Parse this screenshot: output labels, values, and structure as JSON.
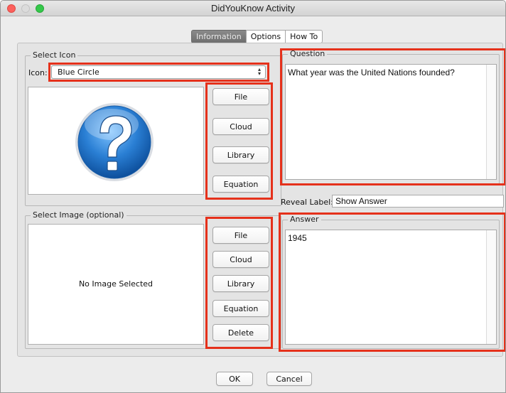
{
  "window": {
    "title": "DidYouKnow Activity"
  },
  "tabs": [
    {
      "label": "Information",
      "active": true
    },
    {
      "label": "Options",
      "active": false
    },
    {
      "label": "How To",
      "active": false
    }
  ],
  "select_icon": {
    "legend": "Select Icon",
    "icon_label": "Icon:",
    "icon_value": "Blue Circle",
    "icon_name": "question-mark-circle-icon",
    "buttons": [
      "File",
      "Cloud",
      "Library",
      "Equation"
    ]
  },
  "select_image": {
    "legend": "Select Image (optional)",
    "empty_text": "No Image Selected",
    "buttons": [
      "File",
      "Cloud",
      "Library",
      "Equation",
      "Delete"
    ]
  },
  "question": {
    "legend": "Question",
    "text": "What year was the United Nations founded?"
  },
  "reveal": {
    "label": "Reveal Label:",
    "value": "Show Answer"
  },
  "answer": {
    "legend": "Answer",
    "text": "1945"
  },
  "footer": {
    "ok": "OK",
    "cancel": "Cancel"
  },
  "colors": {
    "highlight": "#e5311b",
    "icon_blue": "#2a7fd4"
  }
}
